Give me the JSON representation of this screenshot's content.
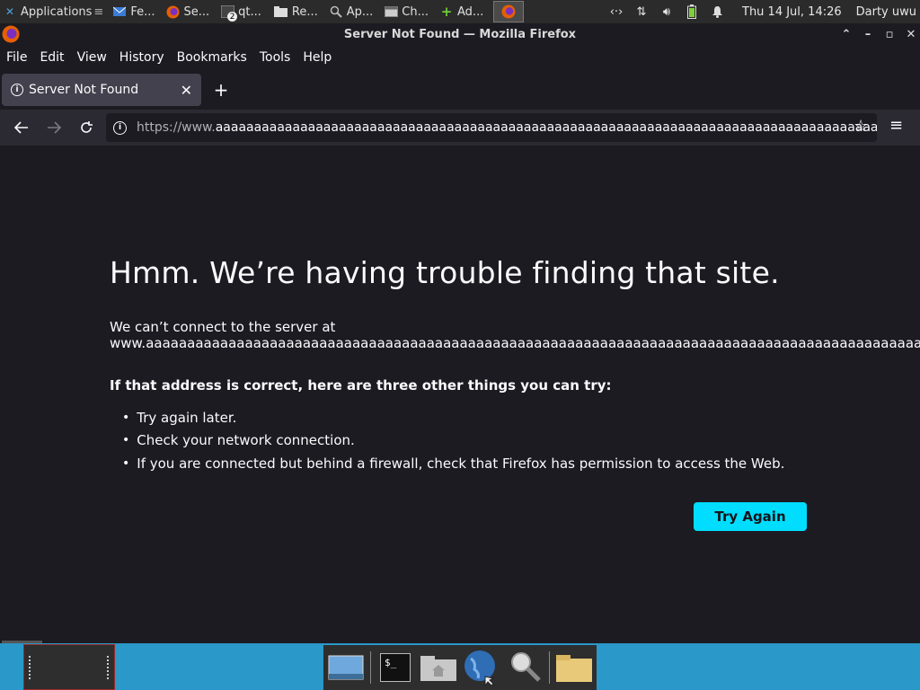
{
  "top_panel": {
    "tasks": [
      {
        "label": "Applications",
        "icon": "xfce-icon"
      },
      {
        "label": "Fe...",
        "icon": "mail-icon"
      },
      {
        "label": "Se...",
        "icon": "firefox-icon"
      },
      {
        "label": "qt...",
        "icon": "terminal-icon",
        "badge": "2"
      },
      {
        "label": "Re...",
        "icon": "folder-icon"
      },
      {
        "label": "Ap...",
        "icon": "search-icon"
      },
      {
        "label": "Ch...",
        "icon": "window-icon"
      },
      {
        "label": "Ad...",
        "icon": "plus-icon"
      }
    ],
    "clock": "Thu 14 Jul, 14:26",
    "user": "Darty uwu"
  },
  "window": {
    "title": "Server Not Found — Mozilla Firefox"
  },
  "menubar": {
    "items": [
      "File",
      "Edit",
      "View",
      "History",
      "Bookmarks",
      "Tools",
      "Help"
    ]
  },
  "tab": {
    "title": "Server Not Found"
  },
  "urlbar": {
    "prefix": "https://www.",
    "host": "aaaaaaaaaaaaaaaaaaaaaaaaaaaaaaaaaaaaaaaaaaaaaaaaaaaaaaaaaaaaaaaaaaaaaaaaaaaaaaaaaaaaaa"
  },
  "error": {
    "title": "Hmm. We’re having trouble finding that site.",
    "desc_line1": "We can’t connect to the server at",
    "desc_host": "www.aaaaaaaaaaaaaaaaaaaaaaaaaaaaaaaaaaaaaaaaaaaaaaaaaaaaaaaaaaaaaaaaaaaaaaaaaaaaaaaaaaaaaaaaaaaaaaaaaaaaaaaaaaaaaaaaaaa",
    "try_heading": "If that address is correct, here are three other things you can try:",
    "suggestions": [
      "Try again later.",
      "Check your network connection.",
      "If you are connected but behind a firewall, check that Firefox has permission to access the Web."
    ],
    "button": "Try Again"
  },
  "colors": {
    "accent": "#00ddff",
    "page_bg": "#1c1b22",
    "toolbar_bg": "#2b2a33",
    "dock_bg": "#2a98c8"
  }
}
